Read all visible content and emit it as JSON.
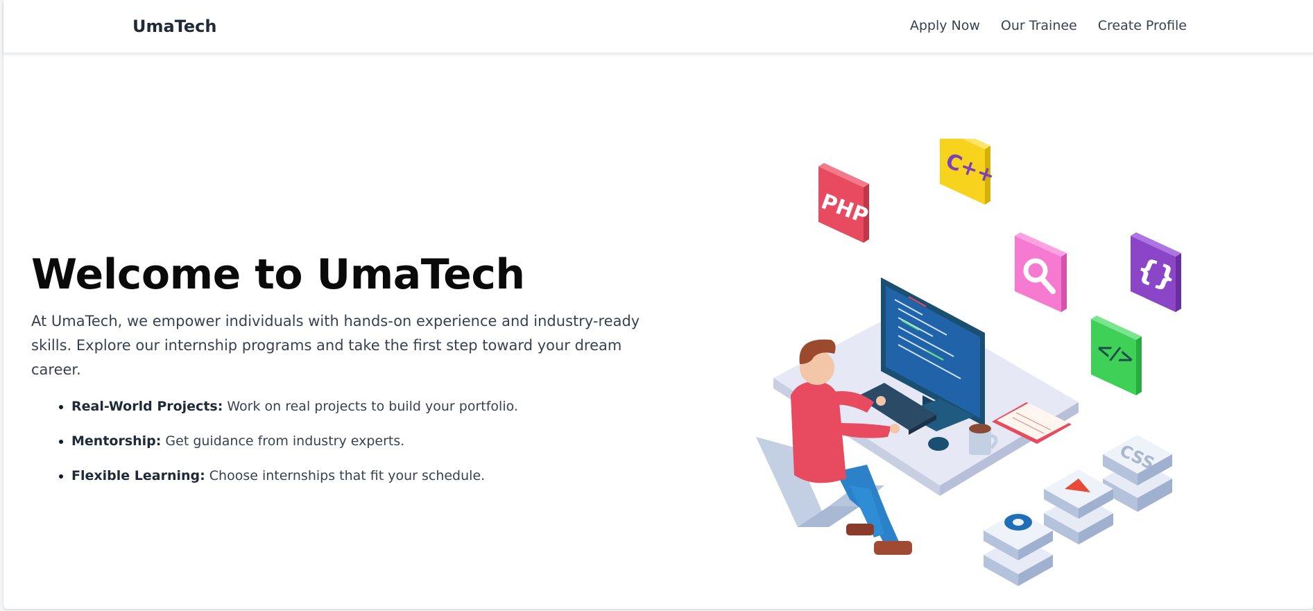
{
  "navbar": {
    "brand": "UmaTech",
    "links": [
      {
        "label": "Apply Now"
      },
      {
        "label": "Our Trainee"
      },
      {
        "label": "Create Profile"
      }
    ]
  },
  "hero": {
    "title": "Welcome to UmaTech",
    "description": "At UmaTech, we empower individuals with hands-on experience and industry-ready skills. Explore our internship programs and take the first step toward your dream career.",
    "features": [
      {
        "title": "Real-World Projects:",
        "text": " Work on real projects to build your portfolio."
      },
      {
        "title": "Mentorship:",
        "text": " Get guidance from industry experts."
      },
      {
        "title": "Flexible Learning:",
        "text": " Choose internships that fit your schedule."
      }
    ]
  },
  "illustration": {
    "tiles": {
      "php": "PHP",
      "cpp": "C++",
      "braces": "{}",
      "code": "</>",
      "css": "CSS"
    }
  },
  "colors": {
    "brand_text": "#1f2937",
    "php_tile": "#e84a5f",
    "cpp_tile": "#f7d31e",
    "search_tile": "#f57ad0",
    "braces_tile": "#8b45c7",
    "code_tile": "#3fd157"
  }
}
